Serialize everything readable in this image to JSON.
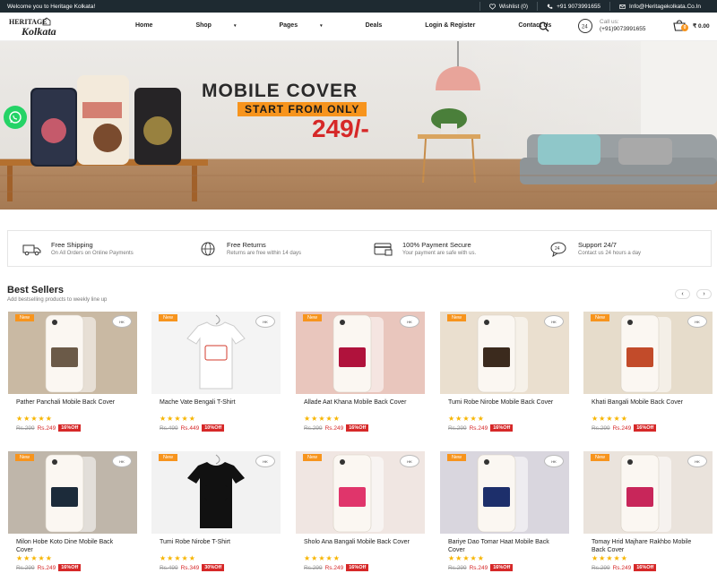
{
  "topbar": {
    "welcome": "Welcome you to Heritage Kolkata!",
    "wishlist": "Wishlist (0)",
    "phone": "+91 9073991655",
    "email": "Info@Heritagekolkata.Co.In"
  },
  "header": {
    "logo_top": "HERITAGE",
    "logo_bottom": "Kolkata",
    "nav": [
      {
        "label": "Home"
      },
      {
        "label": "Shop"
      },
      {
        "label": "Pages"
      },
      {
        "label": "Deals"
      },
      {
        "label": "Login & Register"
      },
      {
        "label": "Contact Us"
      }
    ],
    "call_label": "Call us:",
    "call_number": "(+91)9073991655",
    "cart_count": "0",
    "cart_total": "₹ 0.00"
  },
  "hero": {
    "title": "MOBILE COVER",
    "subtitle": "START FROM ONLY",
    "price": "249/-"
  },
  "features": [
    {
      "title": "Free Shipping",
      "sub": "On All Orders on Online Payments"
    },
    {
      "title": "Free Returns",
      "sub": "Returns are free within 14 days"
    },
    {
      "title": "100% Payment Secure",
      "sub": "Your payment are safe with us."
    },
    {
      "title": "Support 24/7",
      "sub": "Contact us 24 hours a day"
    }
  ],
  "best": {
    "title": "Best Sellers",
    "sub": "Add bestselling products to weekly line up",
    "prev": "‹",
    "next": "›"
  },
  "product_badge": "New",
  "product_stars": "★★★★★",
  "products": [
    {
      "name": "Pather Panchali Mobile Back Cover",
      "old": "Rs.299",
      "now": "Rs.249",
      "off": "16%Off",
      "bg": "#c9b9a3",
      "accent": "#6b5a48"
    },
    {
      "name": "Mache Vate Bengali T-Shirt",
      "old": "Rs.499",
      "now": "Rs.449",
      "off": "10%Off",
      "bg": "#f4f4f4",
      "accent": "#d33b2c"
    },
    {
      "name": "Allade Aat Khana Mobile Back Cover",
      "old": "Rs.299",
      "now": "Rs.249",
      "off": "16%Off",
      "bg": "#e9c6bd",
      "accent": "#b0123c"
    },
    {
      "name": "Tumi Robe Nirobe Mobile Back Cover",
      "old": "Rs.299",
      "now": "Rs.249",
      "off": "16%Off",
      "bg": "#eadfcf",
      "accent": "#3b2a1d"
    },
    {
      "name": "Khati Bangali Mobile Back Cover",
      "old": "Rs.299",
      "now": "Rs.249",
      "off": "16%Off",
      "bg": "#e6dccb",
      "accent": "#c24b2a"
    },
    {
      "name": "Milon Hobe Koto Dine Mobile Back Cover",
      "old": "Rs.299",
      "now": "Rs.249",
      "off": "16%Off",
      "bg": "#bfb6aa",
      "accent": "#1c2b3a"
    },
    {
      "name": "Tumi Robe Nirobe T-Shirt",
      "old": "Rs.499",
      "now": "Rs.349",
      "off": "30%Off",
      "bg": "#f2f2f2",
      "accent": "#111111"
    },
    {
      "name": "Sholo Ana Bangali Mobile Back Cover",
      "old": "Rs.299",
      "now": "Rs.249",
      "off": "16%Off",
      "bg": "#f0e6e2",
      "accent": "#e0356b"
    },
    {
      "name": "Bariye Dao Tomar Haat Mobile Back Cover",
      "old": "Rs.299",
      "now": "Rs.249",
      "off": "16%Off",
      "bg": "#d9d6de",
      "accent": "#1d2f6b"
    },
    {
      "name": "Tomay Hrid Majhare Rakhbo Mobile Back Cover",
      "old": "Rs.299",
      "now": "Rs.249",
      "off": "16%Off",
      "bg": "#eae3dc",
      "accent": "#c8265a"
    }
  ]
}
